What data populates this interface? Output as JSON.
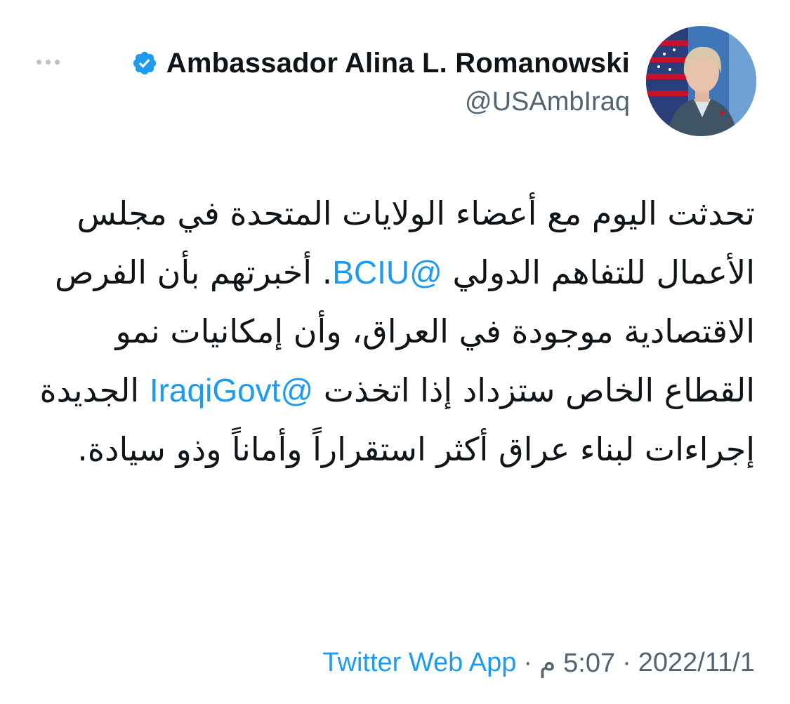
{
  "author": {
    "display_name": "Ambassador Alina L. Romanowski",
    "handle": "@USAmbIraq",
    "verified": true
  },
  "tweet": {
    "segments": {
      "s1": "تحدثت اليوم مع أعضاء الولايات المتحدة في مجلس الأعمال للتفاهم الدولي ",
      "m1": "@BCIU",
      "s2": ". أخبرتهم بأن الفرص الاقتصادية موجودة في العراق، وأن إمكانيات نمو القطاع الخاص ستزداد إذا اتخذت ",
      "m2": "@IraqiGovt",
      "s3": " الجديدة إجراءات لبناء عراق أكثر استقراراً وأماناً وذو سيادة."
    }
  },
  "meta": {
    "date": "2022/11/1",
    "separator": "·",
    "time": "5:07 م",
    "source": "Twitter Web App"
  },
  "icons": {
    "more": "more-horizontal-icon",
    "verified": "verified-badge-icon"
  },
  "colors": {
    "accent": "#1d9bf0",
    "text_primary": "#0f1419",
    "text_secondary": "#536471"
  }
}
